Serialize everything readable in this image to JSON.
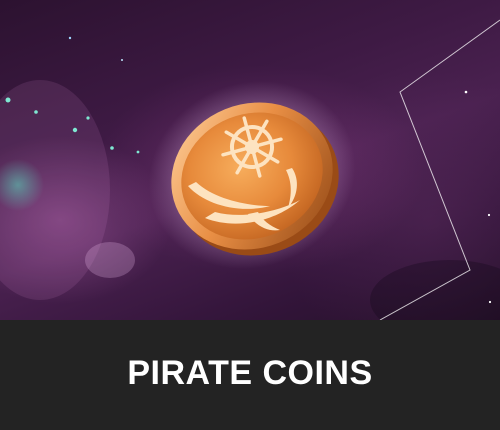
{
  "card": {
    "title": "PIRATE COINS",
    "icon": "pirate-coin-icon"
  },
  "colors": {
    "label_bar": "#232323",
    "title_text": "#ffffff",
    "background_purple": "#3e1a44",
    "coin_gold": "#e8893a"
  }
}
